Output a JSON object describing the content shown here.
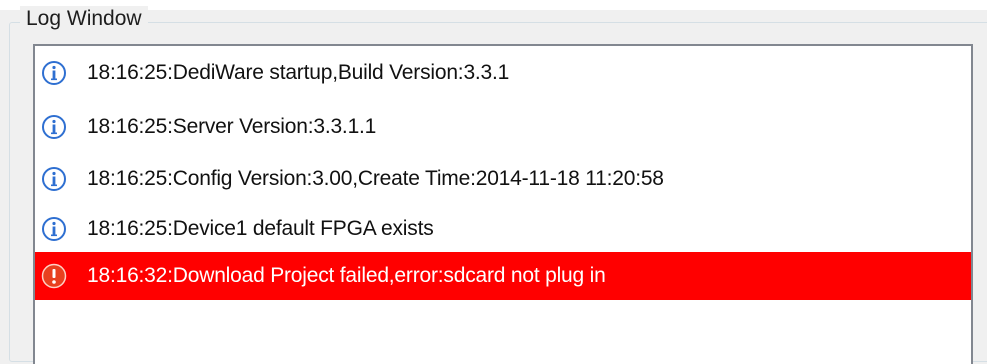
{
  "group_title": "Log Window",
  "log_entries": [
    {
      "level": "info",
      "icon": "info-icon",
      "text": "18:16:25:DediWare startup,Build Version:3.3.1"
    },
    {
      "level": "info",
      "icon": "info-icon",
      "text": "18:16:25:Server Version:3.3.1.1"
    },
    {
      "level": "info",
      "icon": "info-icon",
      "text": "18:16:25:Config Version:3.00,Create Time:2014-11-18 11:20:58"
    },
    {
      "level": "info",
      "icon": "info-icon",
      "text": "18:16:25:Device1 default FPGA exists"
    },
    {
      "level": "error",
      "icon": "error-icon",
      "text": "18:16:32:Download Project failed,error:sdcard not plug in"
    }
  ],
  "colors": {
    "error_row_bg": "#ff0000",
    "info_icon": "#2e6fd1",
    "error_icon": "#e8401f"
  }
}
